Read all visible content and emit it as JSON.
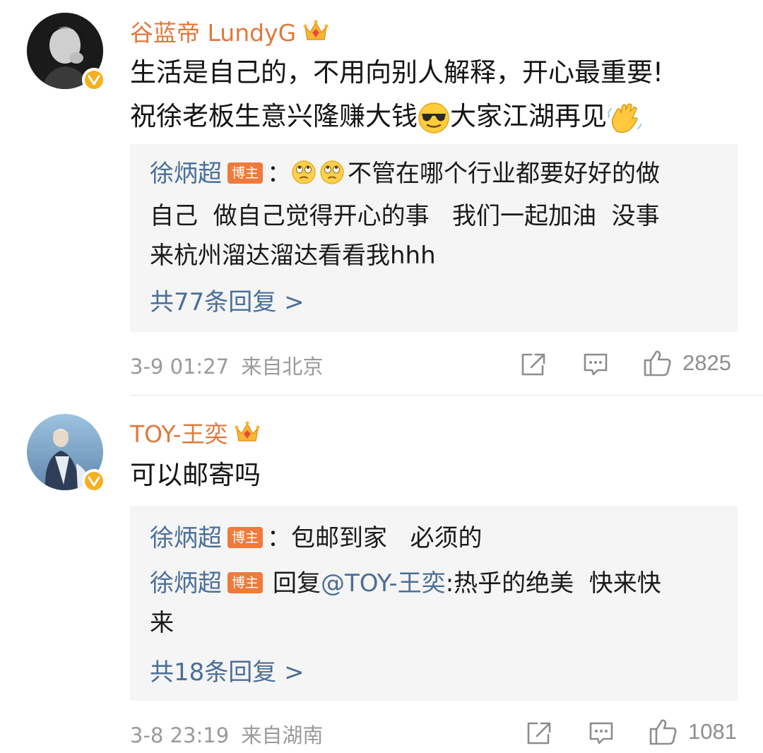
{
  "comments": [
    {
      "username": "谷蓝帝 LundyG",
      "text_line1": "生活是自己的，不用向别人解释，开心最重要!",
      "text_line2a": "祝徐老板生意兴隆赚大钱",
      "text_line2b": "大家江湖再见",
      "replies": [
        {
          "name": "徐炳超",
          "badge": "博主",
          "sep": "：",
          "line1": "不管在哪个行业都要好好的做",
          "line2": "自己  做自己觉得开心的事   我们一起加油  没事",
          "line3": "来杭州溜达溜达看看我hhh"
        }
      ],
      "more_replies": "共77条回复 >",
      "timestamp": "3-9 01:27",
      "location": "来自北京",
      "likes": "2825"
    },
    {
      "username": "TOY-王奕",
      "text": "可以邮寄吗",
      "replies": [
        {
          "name": "徐炳超",
          "badge": "博主",
          "sep": "：",
          "text": "包邮到家   必须的"
        },
        {
          "name": "徐炳超",
          "badge": "博主",
          "prefix": "回复",
          "mention": "@TOY-王奕",
          "text_line1": ":热乎的绝美  快来快",
          "text_line2": "来"
        }
      ],
      "more_replies": "共18条回复 >",
      "timestamp": "3-8 23:19",
      "location": "来自湖南",
      "likes": "1081"
    }
  ],
  "colors": {
    "username": "#e0793b",
    "reply_name": "#4a6f98",
    "host_badge": "#ef7a3c",
    "meta": "#9a9a9a",
    "reply_bg": "#f5f5f5"
  },
  "icons": [
    "crown-icon",
    "verified-icon",
    "rolling-eyes-emoji",
    "sunglasses-emoji",
    "waving-hand-emoji",
    "share-icon",
    "comment-icon",
    "like-icon"
  ]
}
